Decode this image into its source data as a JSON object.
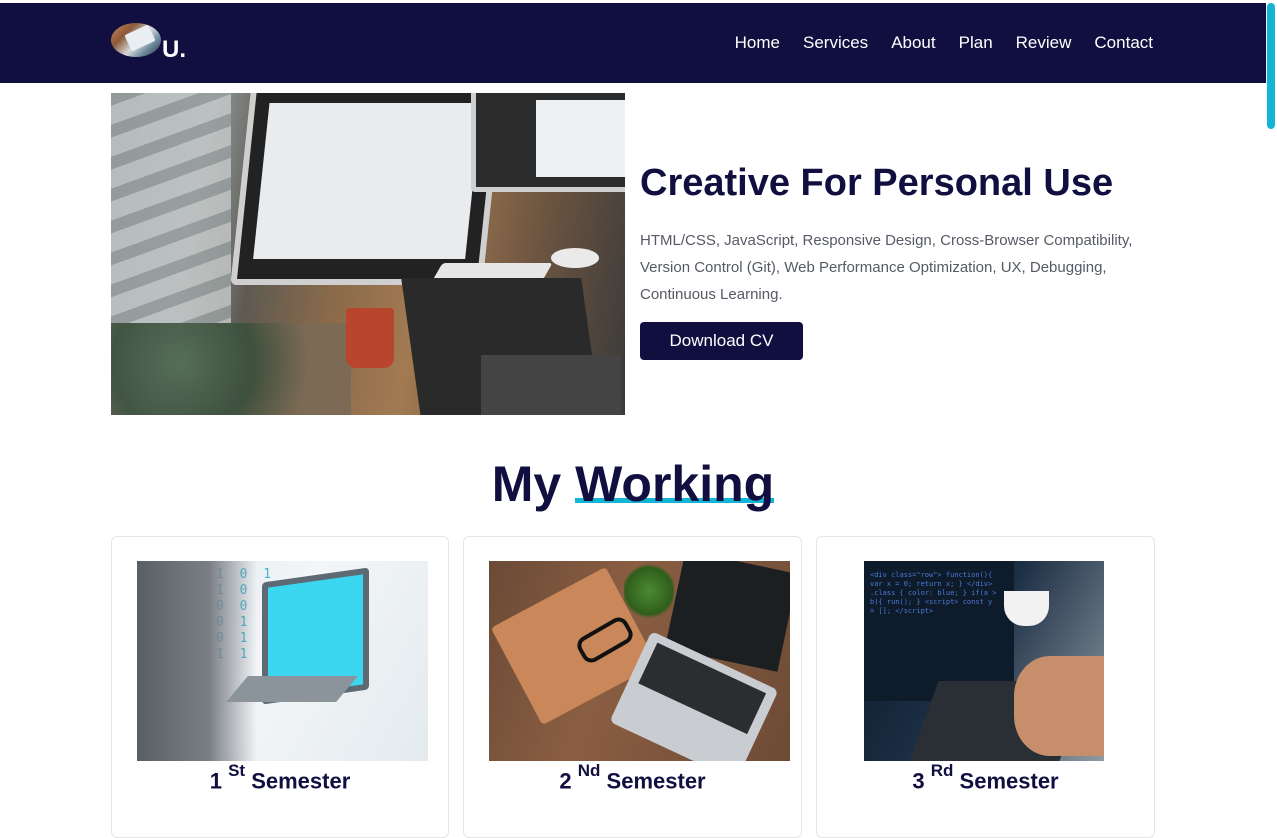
{
  "brand": {
    "logo_text": "U."
  },
  "nav": {
    "items": [
      {
        "label": "Home"
      },
      {
        "label": "Services"
      },
      {
        "label": "About"
      },
      {
        "label": "Plan"
      },
      {
        "label": "Review"
      },
      {
        "label": "Contact"
      }
    ]
  },
  "hero": {
    "title": "Creative For Personal Use",
    "description": "HTML/CSS, JavaScript, Responsive Design, Cross-Browser Compatibility, Version Control (Git), Web Performance Optimization, UX, Debugging, Continuous Learning.",
    "button_label": "Download CV"
  },
  "working": {
    "title_prefix": "My",
    "title_highlight": "Working",
    "cards": [
      {
        "number": "1",
        "suffix": "St",
        "label": "Semester"
      },
      {
        "number": "2",
        "suffix": "Nd",
        "label": "Semester"
      },
      {
        "number": "3",
        "suffix": "Rd",
        "label": "Semester"
      }
    ]
  },
  "colors": {
    "navbar": "#110f40",
    "accent": "#14b4d4",
    "heading": "#110f40",
    "text": "#555a64"
  }
}
